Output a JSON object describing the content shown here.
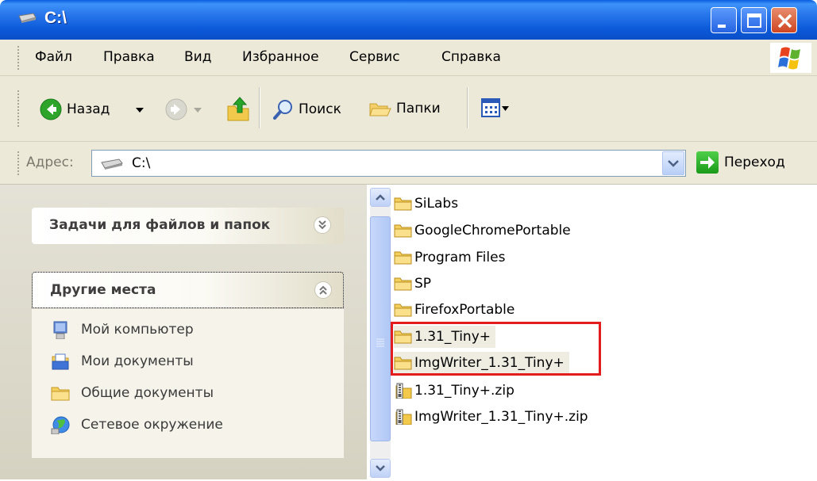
{
  "window": {
    "title": "C:\\"
  },
  "menu": {
    "items": [
      "Файл",
      "Правка",
      "Вид",
      "Избранное",
      "Сервис",
      "Справка"
    ]
  },
  "toolbar": {
    "back_label": "Назад",
    "search_label": "Поиск",
    "folders_label": "Папки"
  },
  "address": {
    "label": "Адрес:",
    "value": "C:\\",
    "go_label": "Переход"
  },
  "taskpane": {
    "tasks_title": "Задачи для файлов и папок",
    "places_title": "Другие места",
    "places": [
      "Мой компьютер",
      "Мои документы",
      "Общие документы",
      "Сетевое окружение"
    ]
  },
  "files": [
    {
      "name": "SiLabs",
      "type": "folder"
    },
    {
      "name": "GoogleChromePortable",
      "type": "folder"
    },
    {
      "name": "Program Files",
      "type": "folder"
    },
    {
      "name": "SP",
      "type": "folder"
    },
    {
      "name": "FirefoxPortable",
      "type": "folder"
    },
    {
      "name": "1.31_Tiny+",
      "type": "folder"
    },
    {
      "name": "ImgWriter_1.31_Tiny+",
      "type": "folder"
    },
    {
      "name": "1.31_Tiny+.zip",
      "type": "zip"
    },
    {
      "name": "ImgWriter_1.31_Tiny+.zip",
      "type": "zip"
    }
  ],
  "colors": {
    "titlebar": "#0b58d8",
    "highlight": "#e31d1d",
    "chrome": "#ece9d8"
  }
}
